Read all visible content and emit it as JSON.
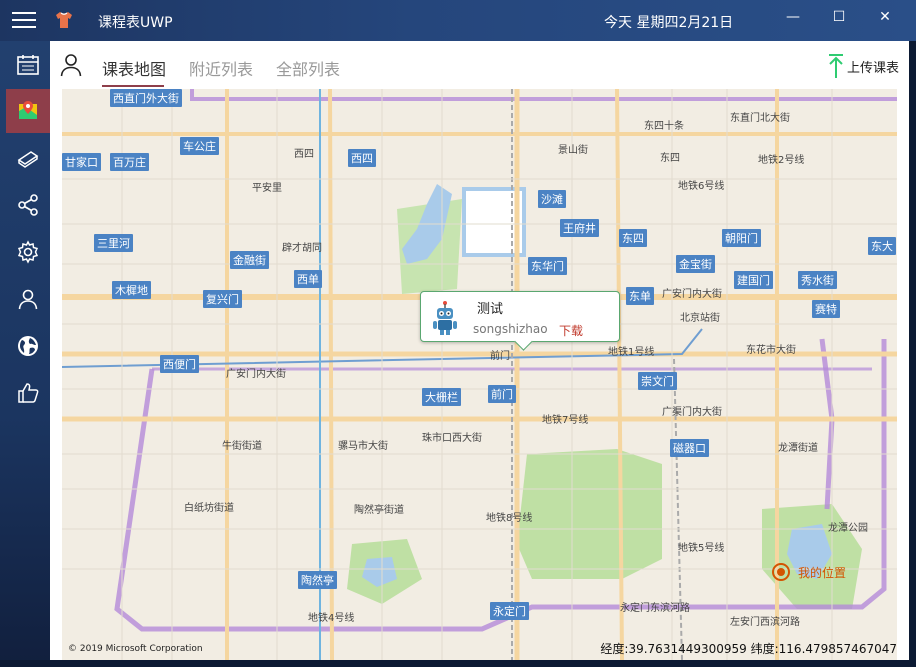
{
  "window": {
    "title": "课程表UWP",
    "date": "今天 星期四2月21日",
    "minimize": "—",
    "maximize": "☐",
    "close": "✕"
  },
  "sidenav": {
    "items": [
      {
        "icon": "calendar-icon"
      },
      {
        "icon": "map-icon",
        "active": true
      },
      {
        "icon": "books-icon"
      },
      {
        "icon": "share-icon"
      },
      {
        "icon": "gear-icon"
      },
      {
        "icon": "person-icon"
      },
      {
        "icon": "globe-icon"
      },
      {
        "icon": "thumbs-up-icon"
      }
    ]
  },
  "topbar": {
    "tabs": [
      {
        "label": "课表地图",
        "active": true
      },
      {
        "label": "附近列表"
      },
      {
        "label": "全部列表"
      }
    ],
    "upload_label": "上传课表"
  },
  "map": {
    "popup": {
      "title": "测试",
      "subtitle": "songshizhao",
      "action": "下载"
    },
    "my_location_label": "我的位置",
    "copyright": "© 2019 Microsoft Corporation",
    "coords": "经度:39.7631449300959  纬度:116.479857467047",
    "stations": [
      "西直门外大街",
      "车公庄",
      "百万庄",
      "甘家口",
      "三里河",
      "木樨地",
      "金融街",
      "复兴门",
      "西单",
      "西四",
      "沙滩",
      "王府井",
      "东四",
      "朝阳门",
      "东大",
      "东华门",
      "金宝街",
      "建国门",
      "秀水街",
      "东单",
      "赛特",
      "西便门",
      "大栅栏",
      "前门",
      "崇文门",
      "磁器口",
      "陶然亭",
      "永定门"
    ],
    "labels": [
      "东四十条",
      "东直门北大街",
      "景山街",
      "地铁6号线",
      "广安门内大街",
      "地铁1号线",
      "前门",
      "北京站街",
      "东花市大街",
      "广安门内大街",
      "地铁7号线",
      "广渠门内大街",
      "牛街街道",
      "骡马市大街",
      "珠市口西大街",
      "龙潭街道",
      "白纸坊街道",
      "陶然亭街道",
      "龙潭公园",
      "永定门东滨河路",
      "左安门西滨河路",
      "地铁4号线",
      "地铁2号线",
      "地铁8号线",
      "地铁5号线",
      "平安里",
      "辟才胡同",
      "西四",
      "东四"
    ]
  }
}
